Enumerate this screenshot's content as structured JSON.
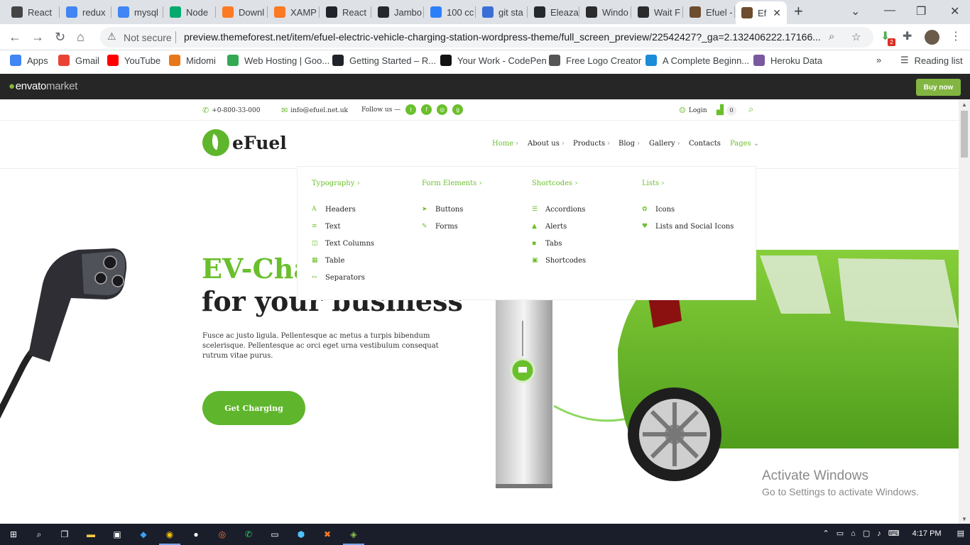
{
  "browser": {
    "tabs": [
      {
        "label": "React",
        "icon": "zeplin-icon",
        "color": "#444"
      },
      {
        "label": "redux",
        "icon": "google-icon",
        "color": "#4285f4"
      },
      {
        "label": "mysql",
        "icon": "google-icon",
        "color": "#4285f4"
      },
      {
        "label": "Node",
        "icon": "w3-icon",
        "color": "#04aa6d"
      },
      {
        "label": "Downl",
        "icon": "xampp-icon",
        "color": "#fb7a24"
      },
      {
        "label": "XAMP",
        "icon": "xampp-icon",
        "color": "#fb7a24"
      },
      {
        "label": "React",
        "icon": "react-icon",
        "color": "#20232a"
      },
      {
        "label": "Jambo",
        "icon": "github-icon",
        "color": "#24292e"
      },
      {
        "label": "100 cc",
        "icon": "c-icon",
        "color": "#2d7ff9"
      },
      {
        "label": "git sta",
        "icon": "a-icon",
        "color": "#3a6fd8"
      },
      {
        "label": "Eleaza",
        "icon": "github-icon",
        "color": "#24292e"
      },
      {
        "label": "Windo",
        "icon": "g-icon",
        "color": "#2b2b2b"
      },
      {
        "label": "Wait F",
        "icon": "g-icon",
        "color": "#2b2b2b"
      },
      {
        "label": "Efuel -",
        "icon": "envato-icon",
        "color": "#6d4c2f"
      },
      {
        "label": "Ef",
        "icon": "envato-icon",
        "color": "#6d4c2f"
      }
    ],
    "new_tab": "+",
    "address": {
      "security": "Not secure",
      "url": "preview.themeforest.net/item/efuel-electric-vehicle-charging-station-wordpress-theme/full_screen_preview/22542427?_ga=2.132406222.17166..."
    },
    "bookmarks": [
      {
        "label": "Apps",
        "icon": "apps-grid-icon",
        "color": "#4285f4"
      },
      {
        "label": "Gmail",
        "icon": "gmail-icon",
        "color": "#ea4335"
      },
      {
        "label": "YouTube",
        "icon": "youtube-icon",
        "color": "#ff0000"
      },
      {
        "label": "Midomi",
        "icon": "midomi-icon",
        "color": "#e8771a"
      },
      {
        "label": "Web Hosting | Goo...",
        "icon": "google-drive-icon",
        "color": "#34a853"
      },
      {
        "label": "Getting Started – R...",
        "icon": "react-icon",
        "color": "#20232a"
      },
      {
        "label": "Your Work - CodePen",
        "icon": "codepen-icon",
        "color": "#111"
      },
      {
        "label": "Free Logo Creator",
        "icon": "logo-creator-icon",
        "color": "#555"
      },
      {
        "label": "A Complete Beginn...",
        "icon": "s-icon",
        "color": "#1a8cd8"
      },
      {
        "label": "Heroku Data",
        "icon": "heroku-icon",
        "color": "#79589f"
      }
    ],
    "reading_list": "Reading list",
    "extension_badge": "2"
  },
  "envato": {
    "logo_main": "envato",
    "logo_sub": "market",
    "buy_now": "Buy now"
  },
  "site": {
    "phone": "+0-800-33-000",
    "email": "info@efuel.net.uk",
    "follow": "Follow us —",
    "social": [
      "twitter-icon",
      "facebook-icon",
      "instagram-icon",
      "google-plus-icon"
    ],
    "login": "Login",
    "cart_count": "0",
    "brand": "eFuel",
    "nav": [
      "Home",
      "About us",
      "Products",
      "Blog",
      "Gallery",
      "Contacts",
      "Pages"
    ],
    "dropdown": [
      {
        "heading": "Typography",
        "items": [
          {
            "label": "Headers",
            "icon": "A"
          },
          {
            "label": "Text",
            "icon": "≡"
          },
          {
            "label": "Text Columns",
            "icon": "◫"
          },
          {
            "label": "Table",
            "icon": "▦"
          },
          {
            "label": "Separators",
            "icon": "↔"
          }
        ]
      },
      {
        "heading": "Form Elements",
        "items": [
          {
            "label": "Buttons",
            "icon": "➤"
          },
          {
            "label": "Forms",
            "icon": "✎"
          }
        ]
      },
      {
        "heading": "Shortcodes",
        "items": [
          {
            "label": "Accordions",
            "icon": "☰"
          },
          {
            "label": "Alerts",
            "icon": "▲"
          },
          {
            "label": "Tabs",
            "icon": "▪"
          },
          {
            "label": "Shortcodes",
            "icon": "▣"
          }
        ]
      },
      {
        "heading": "Lists",
        "items": [
          {
            "label": "Icons",
            "icon": "✿"
          },
          {
            "label": "Lists and Social Icons",
            "icon": "♥"
          }
        ]
      }
    ],
    "hero": {
      "line1": "EV-Cha",
      "line2": "for your business",
      "text": "Fusce ac justo ligula. Pellentesque ac metus a turpis bibendum scelerisque. Pellentesque ac orci eget urna vestibulum consequat rutrum vitae purus.",
      "cta": "Get Charging"
    },
    "activate": {
      "title": "Activate Windows",
      "subtitle": "Go to Settings to activate Windows."
    }
  },
  "taskbar": {
    "time": "4:17 PM"
  },
  "colors": {
    "brand_green": "#6abf2c",
    "envato_green": "#82b541"
  }
}
